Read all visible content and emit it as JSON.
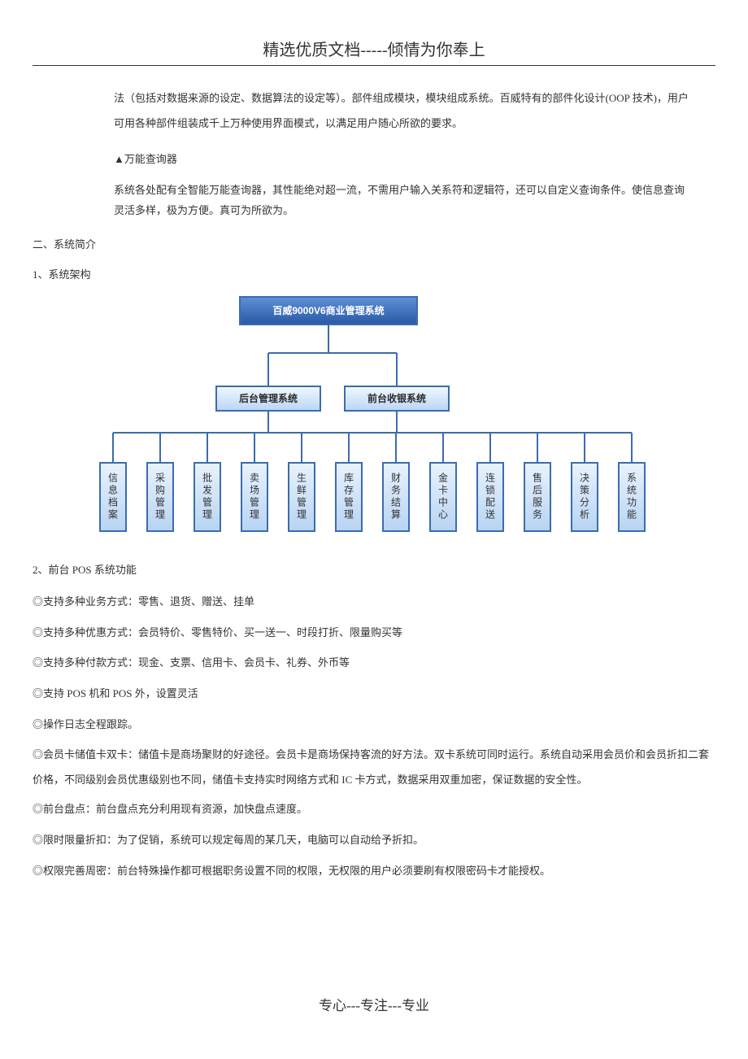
{
  "header": {
    "title": "精选优质文档-----倾情为你奉上"
  },
  "intro": {
    "p1": "法（包括对数据来源的设定、数据算法的设定等）。部件组成模块，模块组成系统。百威特有的部件化设计(OOP 技术)，用户可用各种部件组装成千上万种使用界面模式，以满足用户随心所欲的要求。",
    "feature_heading": "▲万能查询器",
    "feature_body": "系统各处配有全智能万能查询器，其性能绝对超一流，不需用户输入关系符和逻辑符，还可以自定义查询条件。使信息查询灵活多样，极为方便。真可为所欲为。"
  },
  "sections": {
    "h1": "二、系统简介",
    "h1_1": "1、系统架构",
    "h1_2": "2、前台 POS 系统功能"
  },
  "chart_data": {
    "type": "tree",
    "root": {
      "label": "百威9000V6商业管理系统"
    },
    "level2": [
      {
        "label": "后台管理系统"
      },
      {
        "label": "前台收银系统"
      }
    ],
    "leaves": [
      "信息档案",
      "采购管理",
      "批发管理",
      "卖场管理",
      "生鲜管理",
      "库存管理",
      "财务结算",
      "金卡中心",
      "连锁配送",
      "售后服务",
      "决策分析",
      "系统功能"
    ]
  },
  "pos_features": [
    "◎支持多种业务方式：零售、退货、赠送、挂单",
    "◎支持多种优惠方式：会员特价、零售特价、买一送一、时段打折、限量购买等",
    "◎支持多种付款方式：现金、支票、信用卡、会员卡、礼券、外币等",
    "◎支持 POS 机和 POS 外，设置灵活",
    "◎操作日志全程跟踪。",
    "◎会员卡储值卡双卡：储值卡是商场聚财的好途径。会员卡是商场保持客流的好方法。双卡系统可同时运行。系统自动采用会员价和会员折扣二套价格，不同级别会员优惠级别也不同，储值卡支持实时网络方式和 IC 卡方式，数据采用双重加密，保证数据的安全性。",
    "◎前台盘点：前台盘点充分利用现有资源，加快盘点速度。",
    "◎限时限量折扣：为了促销，系统可以规定每周的某几天，电脑可以自动给予折扣。",
    "◎权限完善周密：前台特殊操作都可根据职务设置不同的权限，无权限的用户必须要刷有权限密码卡才能授权。"
  ],
  "footer": "专心---专注---专业"
}
